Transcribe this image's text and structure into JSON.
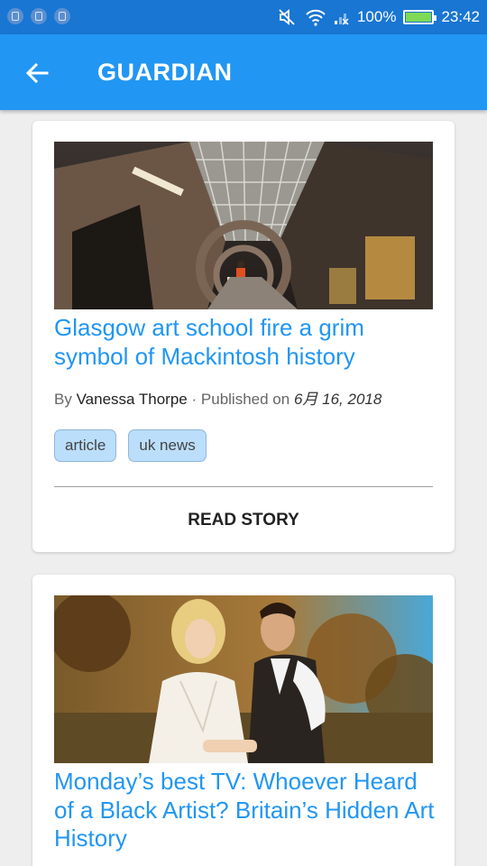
{
  "status_bar": {
    "battery": "100%",
    "time": "23:42",
    "left_icons": [
      "notification-icon",
      "lock-icon",
      "lock-icon"
    ],
    "right_icons": [
      "mute-icon",
      "wifi-icon",
      "no-signal-icon",
      "battery-icon"
    ]
  },
  "app_bar": {
    "title": "GUARDIAN",
    "back_icon": "arrow-left-icon"
  },
  "colors": {
    "status_bar": "#1976d2",
    "app_bar": "#2196f3",
    "headline": "#2196f3",
    "chip_bg": "#bbdefb"
  },
  "articles": [
    {
      "headline": "Glasgow art school fire a grim symbol of Mackintosh history",
      "by_label": "By",
      "author": "Vanessa Thorpe",
      "separator": "·",
      "published_label": "Published on",
      "date": "6月 16, 2018",
      "tags": [
        "article",
        "uk news"
      ],
      "action": "READ STORY",
      "image": "ruined-building-interior-photo"
    },
    {
      "headline": "Monday’s best TV: Whoever Heard of a Black Artist? Britain’s Hidden Art History",
      "image": "couple-film-still-photo"
    }
  ]
}
